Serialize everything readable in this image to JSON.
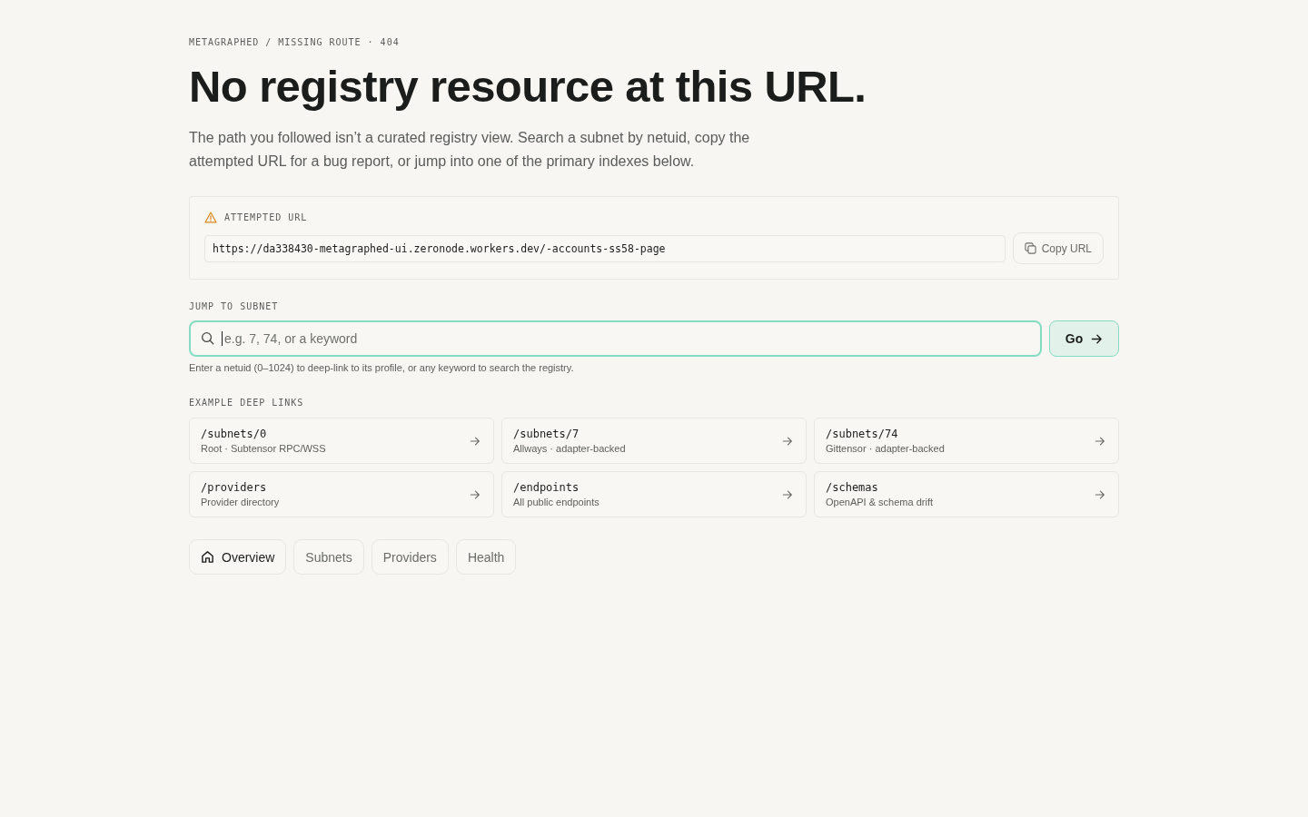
{
  "breadcrumb": "METAGRAPHED / MISSING ROUTE · 404",
  "title": "No registry resource at this URL.",
  "description": "The path you followed isn’t a curated registry view. Search a subnet by netuid, copy the attempted URL for a bug report, or jump into one of the primary indexes below.",
  "attempted_url": {
    "label": "ATTEMPTED URL",
    "value": "https://da338430-metagraphed-ui.zeronode.workers.dev/-accounts-ss58-page",
    "copy_button": "Copy URL"
  },
  "jump": {
    "label": "JUMP TO SUBNET",
    "search": {
      "placeholder": "e.g. 7, 74, or a keyword",
      "focused": true
    },
    "go_button": "Go",
    "hint": "Enter a netuid (0–1024) to deep-link to its profile, or any keyword to search the registry."
  },
  "deep_links": {
    "label": "EXAMPLE DEEP LINKS",
    "items": [
      {
        "path": "/subnets/0",
        "description": "Root · Subtensor RPC/WSS"
      },
      {
        "path": "/subnets/7",
        "description": "Allways · adapter-backed"
      },
      {
        "path": "/subnets/74",
        "description": "Gittensor · adapter-backed"
      },
      {
        "path": "/providers",
        "description": "Provider directory"
      },
      {
        "path": "/endpoints",
        "description": "All public endpoints"
      },
      {
        "path": "/schemas",
        "description": "OpenAPI & schema drift"
      }
    ]
  },
  "nav": [
    {
      "label": "Overview",
      "selected": true
    },
    {
      "label": "Subnets",
      "selected": false
    },
    {
      "label": "Providers",
      "selected": false
    },
    {
      "label": "Health",
      "selected": false
    }
  ]
}
